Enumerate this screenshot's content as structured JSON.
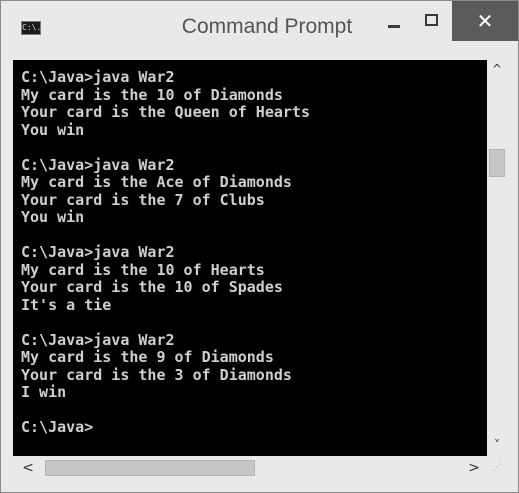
{
  "window": {
    "title": "Command Prompt",
    "icon_label": "C:\\.",
    "controls": {
      "minimize": "minimize-icon",
      "maximize": "maximize-icon",
      "close": "close-icon"
    }
  },
  "console": {
    "text": "C:\\Java>java War2\nMy card is the 10 of Diamonds\nYour card is the Queen of Hearts\nYou win\n\nC:\\Java>java War2\nMy card is the Ace of Diamonds\nYour card is the 7 of Clubs\nYou win\n\nC:\\Java>java War2\nMy card is the 10 of Hearts\nYour card is the 10 of Spades\nIt's a tie\n\nC:\\Java>java War2\nMy card is the 9 of Diamonds\nYour card is the 3 of Diamonds\nI win\n\nC:\\Java>"
  },
  "scrollbars": {
    "up_arrow": "^",
    "down_arrow": "˅",
    "left_arrow": "<",
    "right_arrow": ">"
  },
  "colors": {
    "console_background": "#000000",
    "console_text": "#cfcfcf",
    "window_chrome": "#e9e9e9",
    "close_button": "#5b5b5b"
  }
}
